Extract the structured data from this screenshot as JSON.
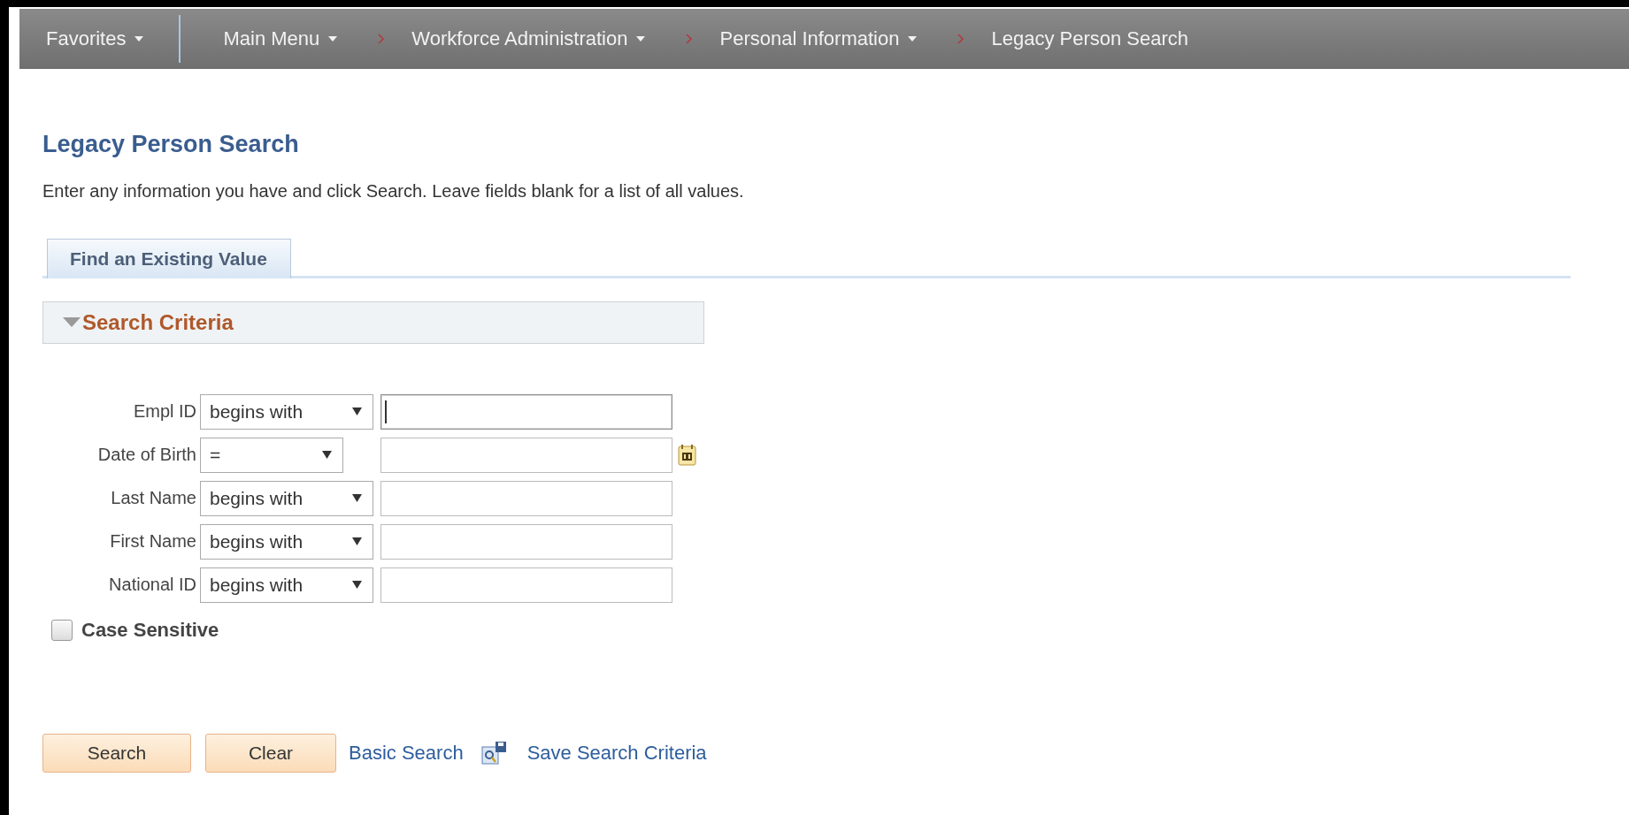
{
  "nav": [
    {
      "kind": "menu",
      "label": "Favorites",
      "dropdown": true
    },
    {
      "kind": "divider"
    },
    {
      "kind": "menu",
      "label": "Main Menu",
      "dropdown": true
    },
    {
      "kind": "chevron"
    },
    {
      "kind": "menu",
      "label": "Workforce Administration",
      "dropdown": true
    },
    {
      "kind": "chevron"
    },
    {
      "kind": "menu",
      "label": "Personal Information",
      "dropdown": true
    },
    {
      "kind": "chevron"
    },
    {
      "kind": "menu",
      "label": "Legacy Person Search",
      "dropdown": false
    }
  ],
  "title": "Legacy Person Search",
  "instructions": "Enter any information you have and click Search. Leave fields blank for a list of all values.",
  "tabs": [
    {
      "label": "Find an Existing Value",
      "selected": true
    }
  ],
  "section": {
    "title": "Search Criteria",
    "expanded": true
  },
  "fields": [
    {
      "label": "Empl ID",
      "kind": "text",
      "operator": "begins with",
      "focused": true
    },
    {
      "label": "Date of Birth",
      "kind": "date",
      "operator": "=",
      "focused": false
    },
    {
      "label": "Last Name",
      "kind": "text",
      "operator": "begins with",
      "focused": false
    },
    {
      "label": "First Name",
      "kind": "text",
      "operator": "begins with",
      "focused": false
    },
    {
      "label": "National ID",
      "kind": "text",
      "operator": "begins with",
      "focused": false
    }
  ],
  "case_sensitive": {
    "label": "Case Sensitive",
    "checked": false
  },
  "buttons": [
    {
      "label": "Search"
    },
    {
      "label": "Clear"
    }
  ],
  "links": [
    {
      "label": "Basic Search"
    },
    {
      "label": "Save Search Criteria"
    }
  ]
}
